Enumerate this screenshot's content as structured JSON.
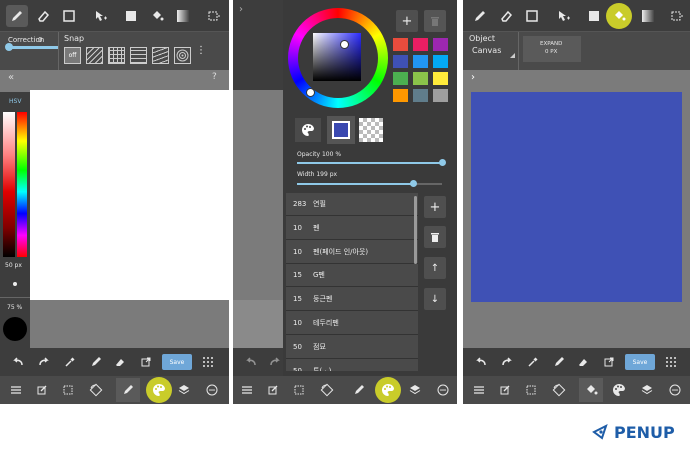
{
  "panel1": {
    "correction_label": "Correction",
    "correction_value": "0",
    "snap_label": "Snap",
    "snap_off": "off",
    "hsv_label": "HSV",
    "brush_size": "50 px",
    "opacity": "75 %",
    "save_label": "Save"
  },
  "panel2": {
    "opacity_label": "Opacity 100 %",
    "opacity_value": 1.0,
    "width_label": "Width 199 px",
    "width_value": 0.8,
    "brushes": [
      {
        "size": "283",
        "name": "연필"
      },
      {
        "size": "10",
        "name": "펜"
      },
      {
        "size": "10",
        "name": "펜(페이드 인/아웃)"
      },
      {
        "size": "15",
        "name": "G펜"
      },
      {
        "size": "15",
        "name": "둥근펜"
      },
      {
        "size": "10",
        "name": "테두리펜"
      },
      {
        "size": "50",
        "name": "점묘"
      },
      {
        "size": "50",
        "name": "투(ᆞ)"
      }
    ],
    "palette": [
      "#e84c3d",
      "#e91e63",
      "#9c27b0",
      "#3f51b5",
      "#2196f3",
      "#03a9f4",
      "#4caf50",
      "#8bc34a",
      "#ffeb3b",
      "#ff9800",
      "#607d8b",
      "#9e9e9e"
    ],
    "current_color": "#3a48b0"
  },
  "panel3": {
    "object_label": "Object",
    "object_value": "Canvas",
    "expand_label": "EXPAND",
    "expand_value": "0 PX",
    "canvas_color": "#3f51b5",
    "save_label": "Save"
  },
  "logo": {
    "text": "PENUP",
    "color": "#1e5da8"
  }
}
